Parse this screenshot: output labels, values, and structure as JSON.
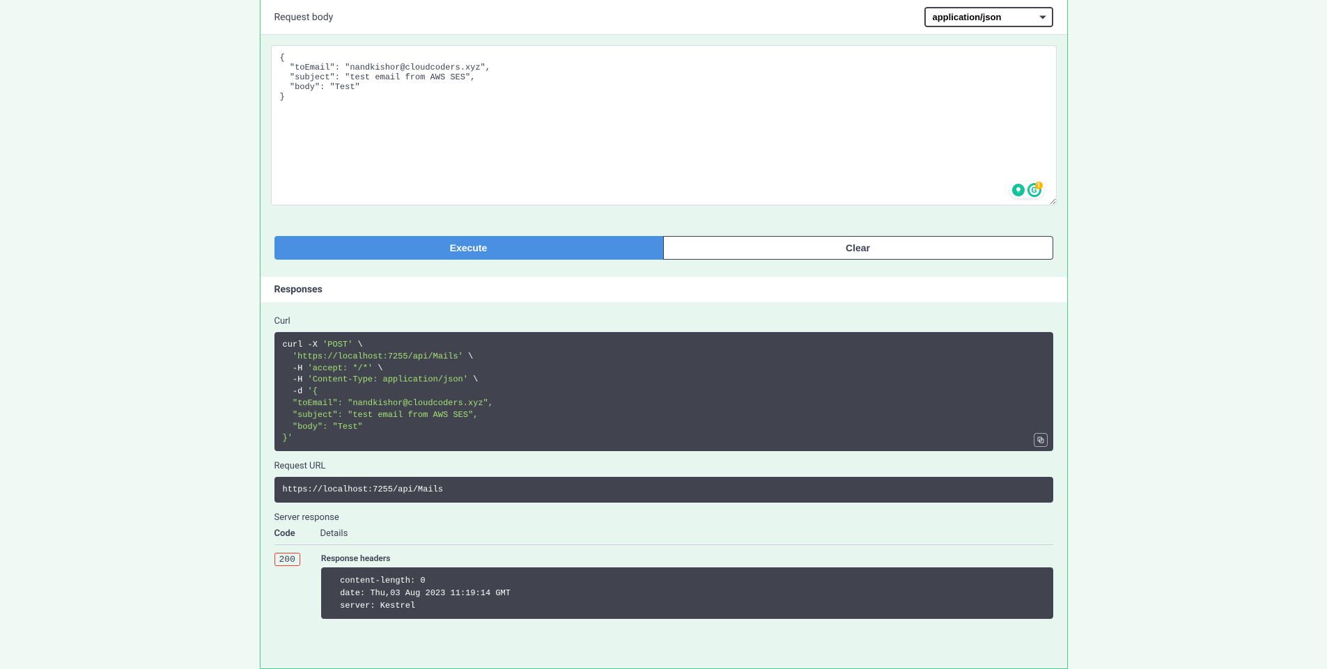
{
  "requestBody": {
    "label": "Request body",
    "contentType": "application/json",
    "value": "{\n  \"toEmail\": \"nandkishor@cloudcoders.xyz\",\n  \"subject\": \"test email from AWS SES\",\n  \"body\": \"Test\"\n}"
  },
  "buttons": {
    "execute": "Execute",
    "clear": "Clear"
  },
  "responses": {
    "heading": "Responses",
    "curlLabel": "Curl",
    "curl": {
      "l1a": "curl -X ",
      "l1b": "'POST'",
      "l1c": " \\",
      "l2a": "  ",
      "l2b": "'https://localhost:7255/api/Mails'",
      "l2c": " \\",
      "l3a": "  -H ",
      "l3b": "'accept: */*'",
      "l3c": " \\",
      "l4a": "  -H ",
      "l4b": "'Content-Type: application/json'",
      "l4c": " \\",
      "l5a": "  -d ",
      "l5b": "'{",
      "l6": "  \"toEmail\": \"nandkishor@cloudcoders.xyz\",",
      "l7": "  \"subject\": \"test email from AWS SES\",",
      "l8": "  \"body\": \"Test\"",
      "l9": "}'"
    },
    "requestUrlLabel": "Request URL",
    "requestUrl": "https://localhost:7255/api/Mails",
    "serverResponseLabel": "Server response",
    "codeHeader": "Code",
    "detailsHeader": "Details",
    "code": "200",
    "responseHeadersLabel": "Response headers",
    "responseHeaders": " content-length: 0 \n date: Thu,03 Aug 2023 11:19:14 GMT \n server: Kestrel "
  }
}
